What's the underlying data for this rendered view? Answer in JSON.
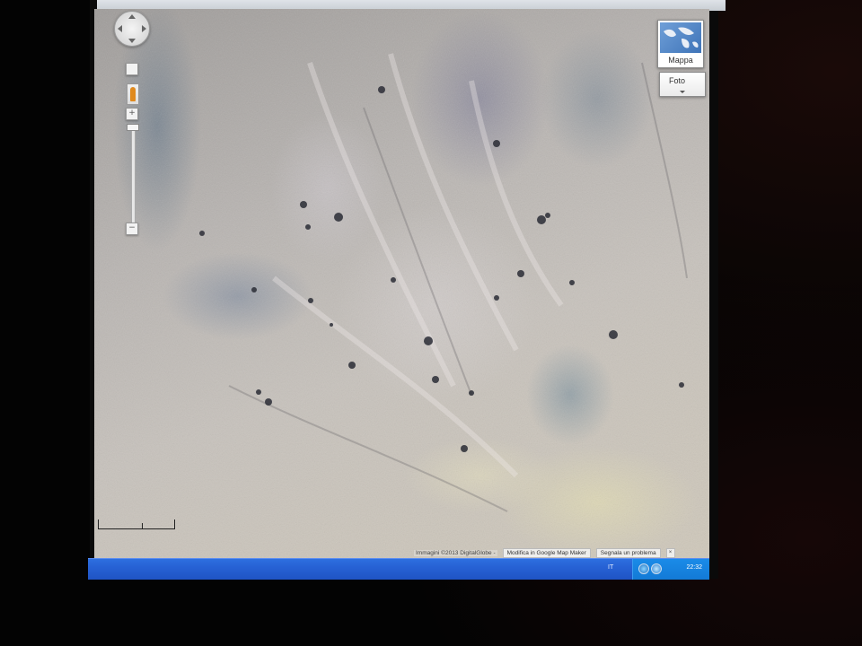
{
  "map": {
    "maptype_map_label": "Mappa",
    "maptype_foto_label": "Foto",
    "attribution": "Immagini ©2013 DigitalGlobe -",
    "edit_link": "Modifica in Google Map Maker",
    "report_link": "Segnala un problema",
    "close_label": "×",
    "zoom_in": "+",
    "zoom_out": "−"
  },
  "taskbar": {
    "language": "IT",
    "clock": "22:32"
  },
  "colors": {
    "taskbar_blue": "#2660d3",
    "tray_blue": "#137ad6",
    "pegman_orange": "#e08a1e"
  },
  "icons": [
    "pan-control-icon",
    "pegman-icon",
    "globe-icon",
    "network-icon",
    "chevron-down-icon"
  ]
}
